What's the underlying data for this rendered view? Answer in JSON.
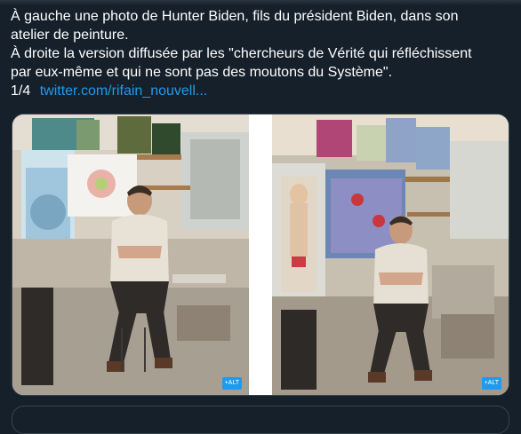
{
  "tweet": {
    "line1": "À gauche une photo de Hunter Biden, fils du président Biden, dans son",
    "line2": "atelier de peinture.",
    "line3": "À droite la version diffusée par les \"chercheurs de Vérité qui réfléchissent",
    "line4": "par eux-même et qui ne sont pas des moutons du Système\".",
    "counter": "1/4",
    "link": "twitter.com/rifain_nouvell..."
  },
  "media": {
    "left_badge": "+ALT",
    "right_badge": "+ALT"
  },
  "colors": {
    "background": "#15202b",
    "text": "#ffffff",
    "link": "#1d9bf0",
    "border": "#38444d"
  }
}
